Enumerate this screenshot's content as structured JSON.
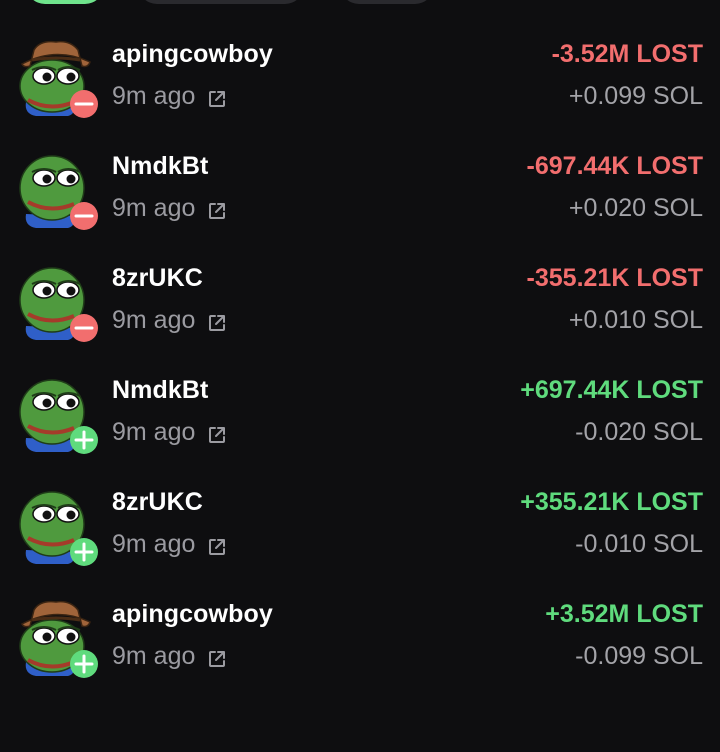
{
  "colors": {
    "background": "#0e0e10",
    "loss": "#f26e6e",
    "gain": "#5fdb7d",
    "muted": "#9b9ba1",
    "accent_pill": "#6fe38c"
  },
  "trades": [
    {
      "user": "apingcowboy",
      "avatar": "cowboy-frog-avatar",
      "action": "minus",
      "time": "9m ago",
      "amount": "-3.52M LOST",
      "sol": "+0.099 SOL"
    },
    {
      "user": "NmdkBt",
      "avatar": "frog-avatar",
      "action": "minus",
      "time": "9m ago",
      "amount": "-697.44K LOST",
      "sol": "+0.020 SOL"
    },
    {
      "user": "8zrUKC",
      "avatar": "frog-avatar",
      "action": "minus",
      "time": "9m ago",
      "amount": "-355.21K LOST",
      "sol": "+0.010 SOL"
    },
    {
      "user": "NmdkBt",
      "avatar": "frog-avatar",
      "action": "plus",
      "time": "9m ago",
      "amount": "+697.44K LOST",
      "sol": "-0.020 SOL"
    },
    {
      "user": "8zrUKC",
      "avatar": "frog-avatar",
      "action": "plus",
      "time": "9m ago",
      "amount": "+355.21K LOST",
      "sol": "-0.010 SOL"
    },
    {
      "user": "apingcowboy",
      "avatar": "cowboy-frog-avatar",
      "action": "plus",
      "time": "9m ago",
      "amount": "+3.52M LOST",
      "sol": "-0.099 SOL"
    }
  ]
}
